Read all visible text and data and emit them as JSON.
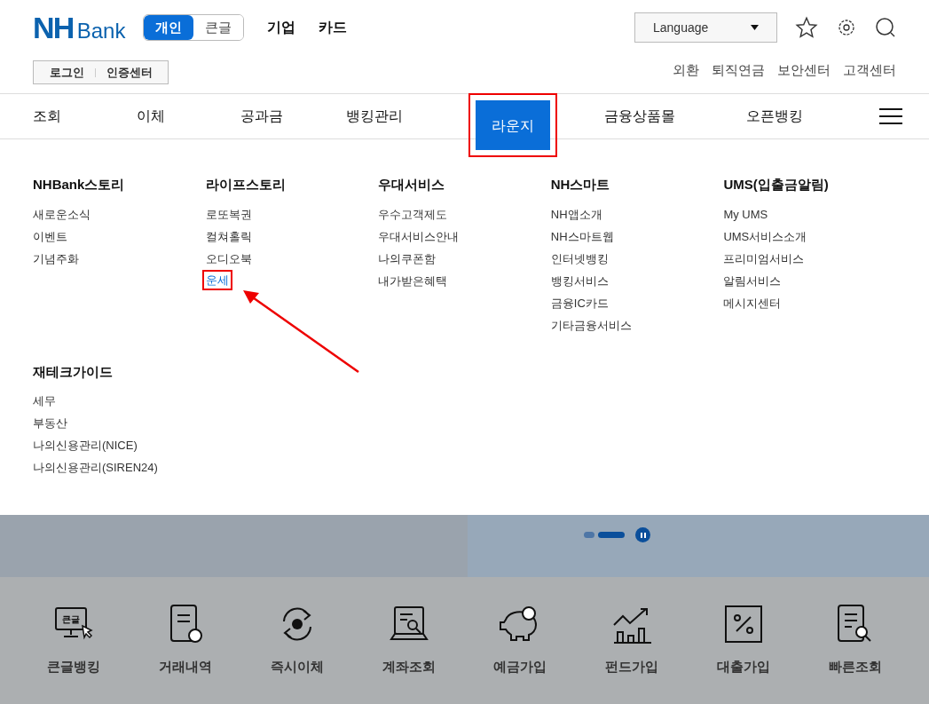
{
  "header": {
    "logo": {
      "mark": "NH",
      "word": "Bank"
    },
    "segments": [
      {
        "label": "개인",
        "selected": true
      },
      {
        "label": "큰글",
        "selected": false
      }
    ],
    "top_links": [
      "기업",
      "카드"
    ],
    "auth_links": [
      "로그인",
      "인증센터"
    ],
    "language": {
      "value": "Language"
    },
    "util_links": [
      "외환",
      "퇴직연금",
      "보안센터",
      "고객센터"
    ]
  },
  "nav": {
    "items": [
      {
        "label": "조회",
        "selected": false,
        "highlighted": false
      },
      {
        "label": "이체",
        "selected": false,
        "highlighted": false
      },
      {
        "label": "공과금",
        "selected": false,
        "highlighted": false
      },
      {
        "label": "뱅킹관리",
        "selected": false,
        "highlighted": false
      },
      {
        "label": "라운지",
        "selected": true,
        "highlighted": true
      },
      {
        "label": "금융상품몰",
        "selected": false,
        "highlighted": false
      },
      {
        "label": "오픈뱅킹",
        "selected": false,
        "highlighted": false
      }
    ]
  },
  "mega_menu": {
    "groups": [
      {
        "title": "NHBank스토리",
        "links": [
          {
            "label": "새로운소식",
            "highlighted": false
          },
          {
            "label": "이벤트",
            "highlighted": false
          },
          {
            "label": "기념주화",
            "highlighted": false
          }
        ]
      },
      {
        "title": "라이프스토리",
        "links": [
          {
            "label": "로또복권",
            "highlighted": false
          },
          {
            "label": "컬쳐홀릭",
            "highlighted": false
          },
          {
            "label": "오디오북",
            "highlighted": false
          },
          {
            "label": "운세",
            "highlighted": true
          }
        ]
      },
      {
        "title": "우대서비스",
        "links": [
          {
            "label": "우수고객제도",
            "highlighted": false
          },
          {
            "label": "우대서비스안내",
            "highlighted": false
          },
          {
            "label": "나의쿠폰함",
            "highlighted": false
          },
          {
            "label": "내가받은혜택",
            "highlighted": false
          }
        ]
      },
      {
        "title": "NH스마트",
        "links": [
          {
            "label": "NH앱소개",
            "highlighted": false
          },
          {
            "label": "NH스마트웹",
            "highlighted": false
          },
          {
            "label": "인터넷뱅킹",
            "highlighted": false
          },
          {
            "label": "뱅킹서비스",
            "highlighted": false
          },
          {
            "label": "금융IC카드",
            "highlighted": false
          },
          {
            "label": "기타금융서비스",
            "highlighted": false
          }
        ]
      },
      {
        "title": "UMS(입출금알림)",
        "links": [
          {
            "label": "My UMS",
            "highlighted": false
          },
          {
            "label": "UMS서비스소개",
            "highlighted": false
          },
          {
            "label": "프리미엄서비스",
            "highlighted": false
          },
          {
            "label": "알림서비스",
            "highlighted": false
          },
          {
            "label": "메시지센터",
            "highlighted": false
          }
        ]
      },
      {
        "title": "재테크가이드",
        "links": [
          {
            "label": "세무",
            "highlighted": false
          },
          {
            "label": "부동산",
            "highlighted": false
          },
          {
            "label": "나의신용관리(NICE)",
            "highlighted": false
          },
          {
            "label": "나의신용관리(SIREN24)",
            "highlighted": false
          }
        ]
      }
    ]
  },
  "carousel": {
    "dots": [
      {
        "selected": false
      },
      {
        "selected": true
      }
    ]
  },
  "quick_menu": [
    {
      "label": "큰글뱅킹",
      "kind": "monitor",
      "icon_text": "큰글"
    },
    {
      "label": "거래내역",
      "kind": "document"
    },
    {
      "label": "즉시이체",
      "kind": "transfer"
    },
    {
      "label": "계좌조회",
      "kind": "laptop"
    },
    {
      "label": "예금가입",
      "kind": "piggy"
    },
    {
      "label": "펀드가입",
      "kind": "chart"
    },
    {
      "label": "대출가입",
      "kind": "percent"
    },
    {
      "label": "빠른조회",
      "kind": "search-doc"
    }
  ]
}
